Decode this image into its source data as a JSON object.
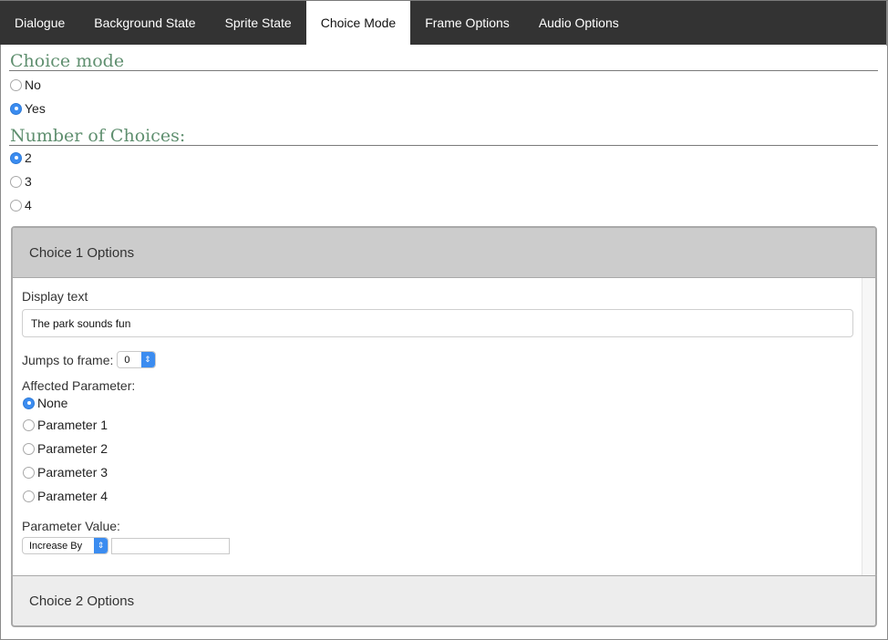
{
  "tabs": [
    {
      "label": "Dialogue",
      "active": false
    },
    {
      "label": "Background State",
      "active": false
    },
    {
      "label": "Sprite State",
      "active": false
    },
    {
      "label": "Choice Mode",
      "active": true
    },
    {
      "label": "Frame Options",
      "active": false
    },
    {
      "label": "Audio Options",
      "active": false
    }
  ],
  "choice_mode": {
    "heading": "Choice mode",
    "options": [
      {
        "label": "No",
        "checked": false
      },
      {
        "label": "Yes",
        "checked": true
      }
    ]
  },
  "number_of_choices": {
    "heading": "Number of Choices:",
    "options": [
      {
        "label": "2",
        "checked": true
      },
      {
        "label": "3",
        "checked": false
      },
      {
        "label": "4",
        "checked": false
      }
    ]
  },
  "choice1": {
    "title": "Choice 1 Options",
    "display_text_label": "Display text",
    "display_text_value": "The park sounds fun",
    "jumps_label": "Jumps to frame:",
    "jumps_value": "0",
    "affected_label": "Affected Parameter:",
    "params": [
      {
        "label": "None",
        "checked": true
      },
      {
        "label": "Parameter 1",
        "checked": false
      },
      {
        "label": "Parameter 2",
        "checked": false
      },
      {
        "label": "Parameter 3",
        "checked": false
      },
      {
        "label": "Parameter 4",
        "checked": false
      }
    ],
    "param_value_label": "Parameter Value:",
    "param_op_value": "Increase By",
    "param_amount_value": ""
  },
  "choice2": {
    "title": "Choice 2 Options"
  },
  "icons": {
    "select_arrow": "⇕"
  },
  "colors": {
    "accent": "#3b8cf0",
    "heading": "#5f8f6f",
    "tabbar": "#333333"
  }
}
